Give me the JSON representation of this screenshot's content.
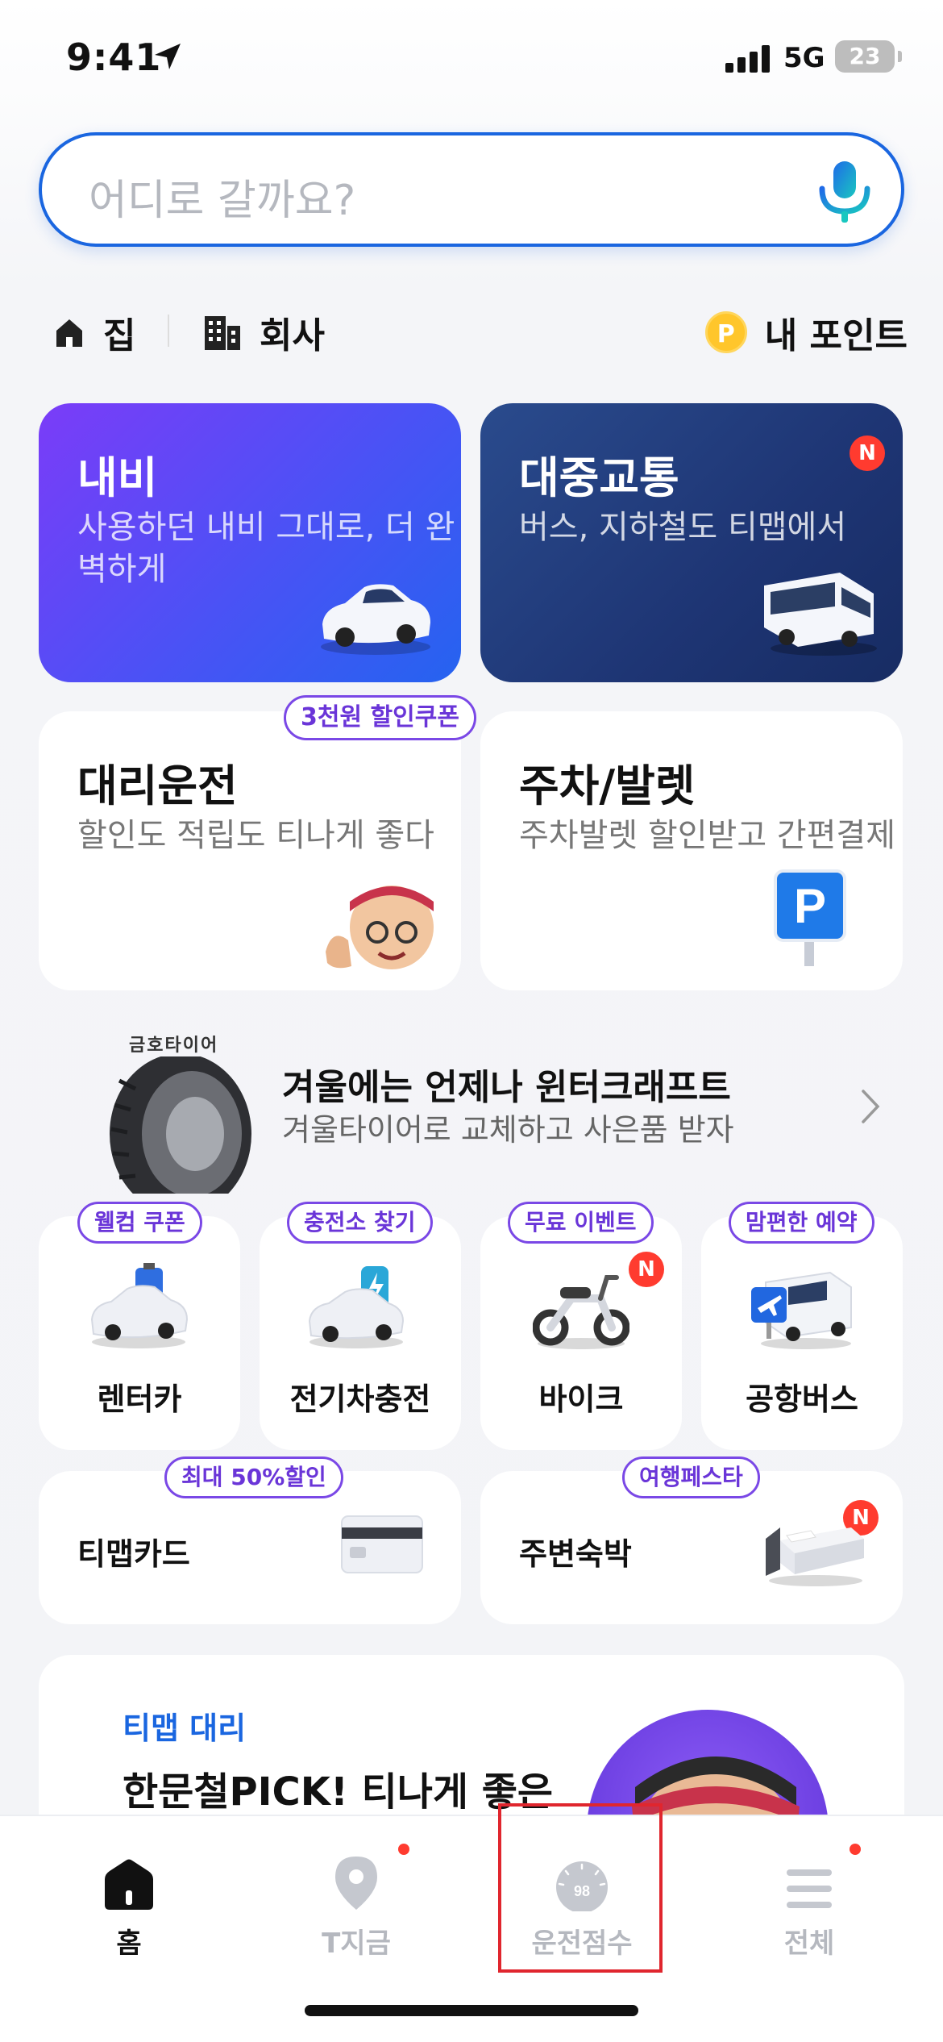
{
  "status_bar": {
    "time": "9:41",
    "network": "5G",
    "battery": "23"
  },
  "search": {
    "placeholder": "어디로 갈까요?"
  },
  "shortcuts": {
    "home": "집",
    "work": "회사",
    "points": "내 포인트",
    "coin_symbol": "P"
  },
  "cards": {
    "navi": {
      "title": "내비",
      "desc": "사용하던 내비 그대로, 더 완벽하게"
    },
    "transit": {
      "title": "대중교통",
      "desc": "버스, 지하철도 티맵에서",
      "badge": "N"
    },
    "driver": {
      "title": "대리운전",
      "desc": "할인도 적립도 티나게 좋다",
      "pill": "3천원 할인쿠폰"
    },
    "parking": {
      "title": "주차/발렛",
      "desc": "주차발렛 할인받고 간편결제"
    }
  },
  "ad": {
    "brand": "금호타이어",
    "headline": "겨울에는 언제나 윈터크래프트",
    "sub": "겨울타이어로 교체하고 사은품 받자"
  },
  "services": [
    {
      "label": "렌터카",
      "pill": "웰컴 쿠폰"
    },
    {
      "label": "전기차충전",
      "pill": "충전소 찾기"
    },
    {
      "label": "바이크",
      "pill": "무료 이벤트",
      "badge": "N"
    },
    {
      "label": "공항버스",
      "pill": "맘편한 예약"
    }
  ],
  "wide_services": [
    {
      "label": "티맵카드",
      "pill": "최대 50%할인"
    },
    {
      "label": "주변숙박",
      "pill": "여행페스타",
      "badge": "N"
    }
  ],
  "promo": {
    "tag": "티맵 대리",
    "headline": "한문철PICK! 티나게 좋은"
  },
  "tabbar": {
    "home": "홈",
    "now": "T지금",
    "score": "운전점수",
    "score_value": "98",
    "all": "전체"
  },
  "colors": {
    "accent": "#1a66e0",
    "purple": "#6a35d8",
    "badge_red": "#ff3b2f",
    "highlight": "#e0262e"
  }
}
